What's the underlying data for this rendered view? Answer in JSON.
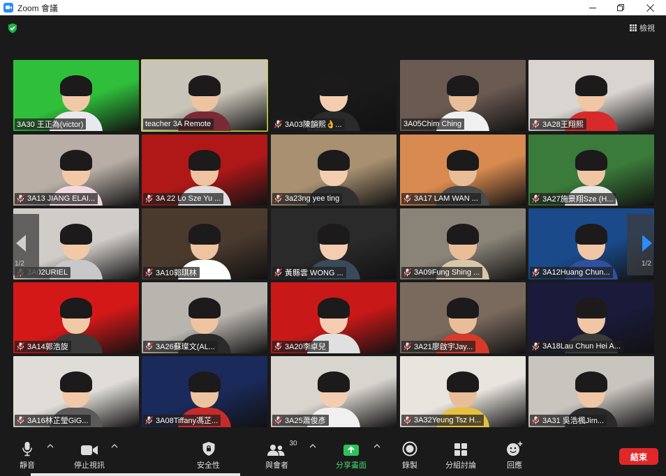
{
  "window": {
    "title": "Zoom 會議",
    "icon": "zoom-app-icon"
  },
  "header": {
    "security_icon": "shield-check-icon",
    "view_label": "檢視",
    "view_icon": "grid-icon"
  },
  "pagination": {
    "left_page": "1/2",
    "right_page": "1/2"
  },
  "participants": [
    {
      "name": "3A30 王正為(victor)",
      "muted": false,
      "active": false,
      "bg": "#2fbf3a"
    },
    {
      "name": "teacher 3A Remote",
      "muted": false,
      "active": true,
      "bg": "#c9c4b8"
    },
    {
      "name": "3A03陳韻熙👌...",
      "muted": true,
      "active": false,
      "bg": "#1a1a1a"
    },
    {
      "name": "3A05Chim Ching",
      "muted": false,
      "active": false,
      "bg": "#6a5a52"
    },
    {
      "name": "3A28王翔熙",
      "muted": true,
      "active": false,
      "bg": "#d8d4d0"
    },
    {
      "name": "3A13 JIANG ELAI...",
      "muted": true,
      "active": false,
      "bg": "#b8aea6"
    },
    {
      "name": "3A 22 Lo Sze Yu ...",
      "muted": true,
      "active": false,
      "bg": "#b01818"
    },
    {
      "name": "3a23ng yee ting",
      "muted": true,
      "active": false,
      "bg": "#a89070"
    },
    {
      "name": "3A17 LAM WAN ...",
      "muted": true,
      "active": false,
      "bg": "#d88a50"
    },
    {
      "name": "3A27施景翔Sze (H...",
      "muted": true,
      "active": false,
      "bg": "#3a7a3a"
    },
    {
      "name": "3A02URIEL",
      "muted": true,
      "active": false,
      "bg": "#d0ccc8"
    },
    {
      "name": "3A10郭琪林",
      "muted": true,
      "active": false,
      "bg": "#4a3a2e"
    },
    {
      "name": "黃縣雲 WONG ...",
      "muted": true,
      "active": false,
      "bg": "#2a2a2a"
    },
    {
      "name": "3A09Fung Shing ...",
      "muted": true,
      "active": false,
      "bg": "#8a8478"
    },
    {
      "name": "3A12Huang Chun...",
      "muted": true,
      "active": false,
      "bg": "#1a4a8a"
    },
    {
      "name": "3A14郭浩旋",
      "muted": true,
      "active": false,
      "bg": "#d41818"
    },
    {
      "name": "3A26蘇璨文(AL...",
      "muted": true,
      "active": false,
      "bg": "#b8b4ae"
    },
    {
      "name": "3A20李卓兒",
      "muted": true,
      "active": false,
      "bg": "#c81818"
    },
    {
      "name": "3A21廖啟宇Jay...",
      "muted": true,
      "active": false,
      "bg": "#7a6a5e"
    },
    {
      "name": "3A18Lau Chun Hei A...",
      "muted": true,
      "active": false,
      "bg": "#1a1a3a"
    },
    {
      "name": "3A16林芷瑩GiG...",
      "muted": true,
      "active": false,
      "bg": "#e0ddd8"
    },
    {
      "name": "3A08Tiffany馮芷...",
      "muted": true,
      "active": false,
      "bg": "#1a2a5a"
    },
    {
      "name": "3A25蕭俊彥",
      "muted": true,
      "active": false,
      "bg": "#d8d4ce"
    },
    {
      "name": "3A32Yeung Tsz H...",
      "muted": true,
      "active": false,
      "bg": "#e8e4de"
    },
    {
      "name": "3A31 吳浩楓Jim...",
      "muted": true,
      "active": false,
      "bg": "#c8c4be"
    }
  ],
  "toolbar": {
    "mute_label": "靜音",
    "video_label": "停止視訊",
    "security_label": "安全性",
    "participants_label": "與會者",
    "participants_count": "30",
    "share_label": "分享畫面",
    "record_label": "錄製",
    "breakout_label": "分組討論",
    "reactions_label": "回應",
    "end_label": "結束"
  }
}
